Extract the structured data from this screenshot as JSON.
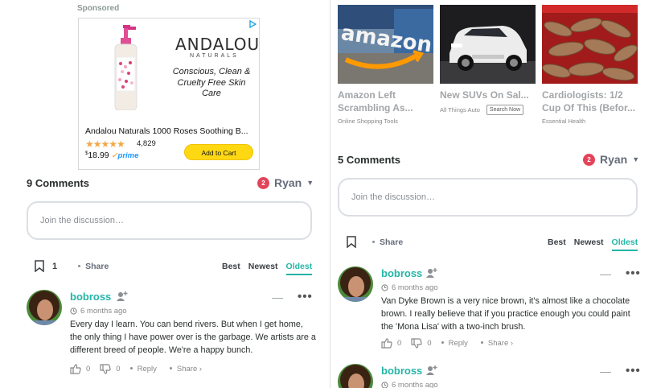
{
  "left": {
    "ad": {
      "sponsored_label": "Sponsored",
      "brand": "ANDALOU",
      "brand_sub": "NATURALS",
      "tagline": "Conscious, Clean & Cruelty Free Skin Care",
      "product_name": "Andalou Naturals 1000 Roses Soothing B...",
      "stars": "★★★★★",
      "rating_value": 4.5,
      "rating_count": "4,829",
      "price_symbol": "$",
      "price": "18.99",
      "prime": "prime",
      "cta": "Add to Cart"
    },
    "comments": {
      "count_label": "9 Comments",
      "notifications": "2",
      "user": "Ryan",
      "join_placeholder": "Join the discussion…",
      "favorites": "1",
      "share": "Share",
      "sort": [
        "Best",
        "Newest",
        "Oldest"
      ],
      "active_sort": "Oldest",
      "items": [
        {
          "author": "bobross",
          "time": "6 months ago",
          "text": "Every day I learn. You can bend rivers. But when I get home, the only thing I have power over is the garbage. We artists are a different breed of people. We're a happy bunch.",
          "upvotes": "0",
          "downvotes": "0",
          "reply": "Reply",
          "share": "Share ›"
        }
      ]
    }
  },
  "right": {
    "recommendations": [
      {
        "title": "Amazon Left Scrambling As...",
        "source": "Online Shopping Tools",
        "thumb_icon": "amazon-logo-image"
      },
      {
        "title": "New SUVs On Sal...",
        "source": "All Things Auto",
        "button": "Search Now",
        "thumb_icon": "white-suv-image"
      },
      {
        "title": "Cardiologists: 1/2 Cup Of This (Befor...",
        "source": "Essential Health",
        "thumb_icon": "tamarind-pods-image"
      }
    ],
    "comments": {
      "count_label": "5 Comments",
      "notifications": "2",
      "user": "Ryan",
      "join_placeholder": "Join the discussion…",
      "share": "Share",
      "sort": [
        "Best",
        "Newest",
        "Oldest"
      ],
      "active_sort": "Oldest",
      "items": [
        {
          "author": "bobross",
          "time": "6 months ago",
          "text": "Van Dyke Brown is a very nice brown, it's almost like a chocolate brown. I really believe that if you practice enough you could paint the 'Mona Lisa' with a two-inch brush.",
          "upvotes": "0",
          "downvotes": "0",
          "reply": "Reply",
          "share": "Share ›"
        },
        {
          "author": "bobross",
          "time": "6 months ago"
        }
      ]
    }
  },
  "colors": {
    "accent": "#24b5a6",
    "notification": "#e3445a",
    "cta": "#ffd814"
  }
}
